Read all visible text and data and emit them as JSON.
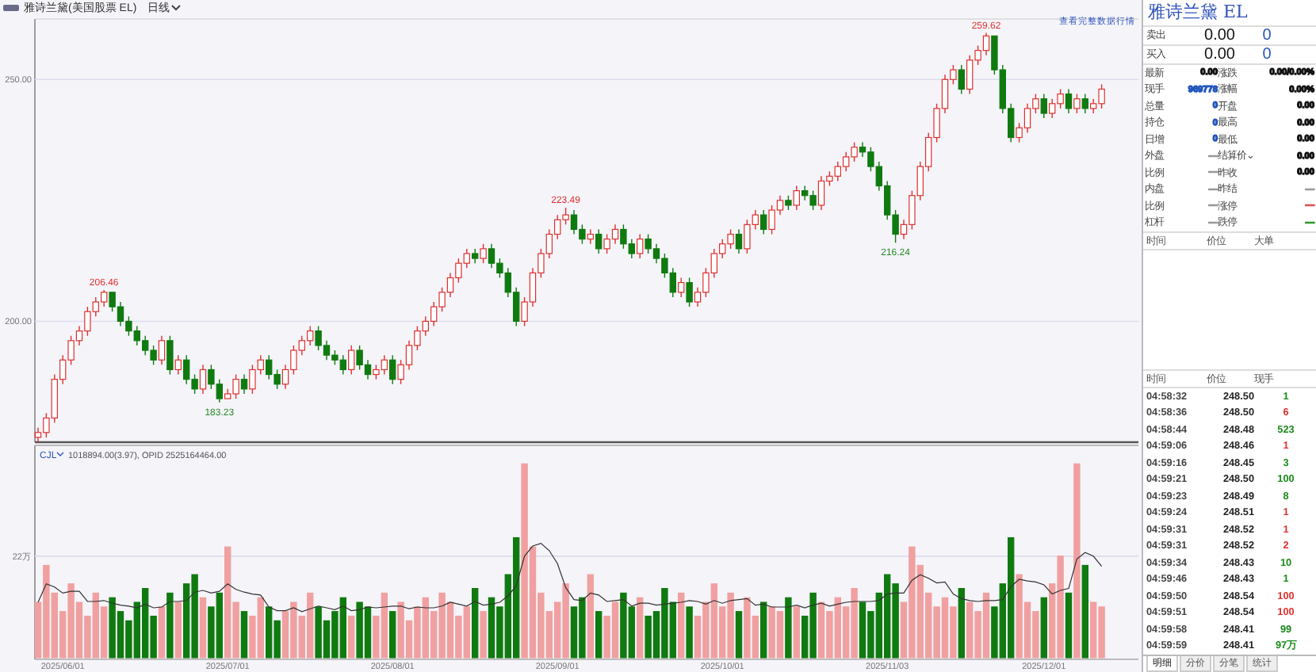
{
  "header": {
    "title": "雅诗兰黛(美国股票 EL)",
    "period": "日线"
  },
  "price_chart": {
    "link": "查看完整数据行情",
    "chart_data": {
      "type": "candlestick",
      "ohlc": [
        [
          176,
          178,
          175,
          177
        ],
        [
          177,
          181,
          176,
          180
        ],
        [
          180,
          189,
          179,
          188
        ],
        [
          188,
          193,
          187,
          192
        ],
        [
          192,
          197,
          191,
          196
        ],
        [
          196,
          199,
          195,
          198
        ],
        [
          198,
          203,
          197,
          202
        ],
        [
          202,
          205,
          201,
          204
        ],
        [
          204,
          206.46,
          203,
          206
        ],
        [
          206,
          206,
          202,
          203
        ],
        [
          203,
          204,
          199,
          200
        ],
        [
          200,
          201,
          197,
          198
        ],
        [
          198,
          199,
          195,
          196
        ],
        [
          196,
          197,
          193,
          194
        ],
        [
          194,
          195,
          191,
          192
        ],
        [
          192,
          197,
          191,
          196
        ],
        [
          196,
          197,
          189,
          190
        ],
        [
          190,
          193,
          189,
          192
        ],
        [
          192,
          193,
          187,
          188
        ],
        [
          188,
          189,
          185,
          186
        ],
        [
          186,
          191,
          185,
          190
        ],
        [
          190,
          191,
          186,
          187
        ],
        [
          187,
          188,
          183.23,
          184
        ],
        [
          184,
          186,
          184,
          185
        ],
        [
          185,
          189,
          184,
          188
        ],
        [
          188,
          189,
          185,
          186
        ],
        [
          186,
          191,
          185,
          190
        ],
        [
          190,
          193,
          189,
          192
        ],
        [
          192,
          193,
          188,
          189
        ],
        [
          189,
          190,
          186,
          187
        ],
        [
          187,
          191,
          186,
          190
        ],
        [
          190,
          195,
          189,
          194
        ],
        [
          194,
          197,
          193,
          196
        ],
        [
          196,
          199,
          195,
          198
        ],
        [
          198,
          199,
          194,
          195
        ],
        [
          195,
          196,
          192,
          193
        ],
        [
          193,
          194,
          191,
          192
        ],
        [
          192,
          193,
          189,
          190
        ],
        [
          190,
          195,
          189,
          194
        ],
        [
          194,
          195,
          190,
          191
        ],
        [
          191,
          192,
          188,
          189
        ],
        [
          189,
          191,
          188,
          190
        ],
        [
          190,
          193,
          189,
          192
        ],
        [
          192,
          193,
          187,
          188
        ],
        [
          188,
          192,
          187,
          191
        ],
        [
          191,
          196,
          190,
          195
        ],
        [
          195,
          199,
          194,
          198
        ],
        [
          198,
          201,
          197,
          200
        ],
        [
          200,
          204,
          199,
          203
        ],
        [
          203,
          207,
          202,
          206
        ],
        [
          206,
          210,
          205,
          209
        ],
        [
          209,
          213,
          208,
          212
        ],
        [
          212,
          215,
          211,
          214
        ],
        [
          214,
          215,
          212,
          213
        ],
        [
          213,
          216,
          212,
          215
        ],
        [
          215,
          216,
          211,
          212
        ],
        [
          212,
          213,
          209,
          210
        ],
        [
          210,
          211,
          205,
          206
        ],
        [
          206,
          207,
          199,
          200
        ],
        [
          200,
          205,
          199,
          204
        ],
        [
          204,
          211,
          203,
          210
        ],
        [
          210,
          215,
          209,
          214
        ],
        [
          214,
          219,
          213,
          218
        ],
        [
          218,
          222,
          217,
          221
        ],
        [
          221,
          223.49,
          220,
          222
        ],
        [
          222,
          223,
          218,
          219
        ],
        [
          219,
          220,
          216,
          217
        ],
        [
          217,
          219,
          216,
          218
        ],
        [
          218,
          219,
          214,
          215
        ],
        [
          215,
          218,
          214,
          217
        ],
        [
          217,
          220,
          216,
          219
        ],
        [
          219,
          220,
          215,
          216
        ],
        [
          216,
          217,
          213,
          214
        ],
        [
          214,
          218,
          213,
          217
        ],
        [
          217,
          218,
          214,
          215
        ],
        [
          215,
          216,
          212,
          213
        ],
        [
          213,
          214,
          209,
          210
        ],
        [
          210,
          211,
          205,
          206
        ],
        [
          206,
          209,
          205,
          208
        ],
        [
          208,
          209,
          203,
          204
        ],
        [
          204,
          207,
          203,
          206
        ],
        [
          206,
          211,
          205,
          210
        ],
        [
          210,
          215,
          209,
          214
        ],
        [
          214,
          217,
          213,
          216
        ],
        [
          216,
          219,
          215,
          218
        ],
        [
          218,
          219,
          214,
          215
        ],
        [
          215,
          221,
          214,
          220
        ],
        [
          220,
          223,
          219,
          222
        ],
        [
          222,
          223,
          218,
          219
        ],
        [
          219,
          224,
          218,
          223
        ],
        [
          223,
          226,
          222,
          225
        ],
        [
          225,
          226,
          223,
          224
        ],
        [
          224,
          228,
          223,
          227
        ],
        [
          227,
          228,
          225,
          226
        ],
        [
          226,
          227,
          223,
          224
        ],
        [
          224,
          230,
          223,
          229
        ],
        [
          229,
          231,
          228,
          230
        ],
        [
          230,
          233,
          229,
          232
        ],
        [
          232,
          235,
          231,
          234
        ],
        [
          234,
          237,
          233,
          236
        ],
        [
          236,
          237,
          234,
          235
        ],
        [
          235,
          236,
          231,
          232
        ],
        [
          232,
          233,
          227,
          228
        ],
        [
          228,
          229,
          221,
          222
        ],
        [
          222,
          223,
          216.24,
          218
        ],
        [
          218,
          221,
          217,
          220
        ],
        [
          220,
          227,
          219,
          226
        ],
        [
          226,
          233,
          225,
          232
        ],
        [
          232,
          239,
          231,
          238
        ],
        [
          238,
          245,
          237,
          244
        ],
        [
          244,
          251,
          243,
          250
        ],
        [
          250,
          253,
          249,
          252
        ],
        [
          252,
          253,
          247,
          248
        ],
        [
          248,
          255,
          247,
          254
        ],
        [
          254,
          257,
          253,
          256
        ],
        [
          256,
          259.62,
          255,
          259
        ],
        [
          259,
          259,
          251,
          252
        ],
        [
          252,
          253,
          243,
          244
        ],
        [
          244,
          245,
          237,
          238
        ],
        [
          238,
          241,
          237,
          240
        ],
        [
          240,
          245,
          239,
          244
        ],
        [
          244,
          247,
          243,
          246
        ],
        [
          246,
          247,
          242,
          243
        ],
        [
          243,
          246,
          242,
          245
        ],
        [
          245,
          248,
          244,
          247
        ],
        [
          247,
          248,
          243,
          244
        ],
        [
          244,
          247,
          243,
          246
        ],
        [
          246,
          247,
          243,
          244
        ],
        [
          244,
          246,
          243,
          245
        ],
        [
          245,
          249,
          244,
          248
        ]
      ],
      "ylim": [
        175,
        262.5
      ],
      "yticks": [
        {
          "value": 250,
          "label": "250.00"
        },
        {
          "value": 200,
          "label": "200.00"
        }
      ],
      "annotations": [
        {
          "y": 206.46,
          "text": "206.46"
        },
        {
          "y": 183.23,
          "text": "183.23"
        },
        {
          "y": 223.49,
          "text": "223.49"
        },
        {
          "y": 216.24,
          "text": "216.24"
        },
        {
          "y": 259.62,
          "text": "259.62"
        }
      ]
    }
  },
  "volume_chart": {
    "legend_text": "1018894.00(3.97), OPID 2525164464.00",
    "chart_data": {
      "type": "bar",
      "categories": [
        null,
        null,
        null,
        "2025/06/01",
        null,
        null,
        null,
        null,
        null,
        null,
        null,
        null,
        null,
        null,
        null,
        null,
        null,
        null,
        null,
        null,
        null,
        null,
        null,
        "2025/07/01",
        null,
        null,
        null,
        null,
        null,
        null,
        null,
        null,
        null,
        null,
        null,
        null,
        null,
        null,
        null,
        null,
        null,
        null,
        null,
        "2025/08/01",
        null,
        null,
        null,
        null,
        null,
        null,
        null,
        null,
        null,
        null,
        null,
        null,
        null,
        null,
        null,
        null,
        null,
        null,
        null,
        "2025/09/01",
        null,
        null,
        null,
        null,
        null,
        null,
        null,
        null,
        null,
        null,
        null,
        null,
        null,
        null,
        null,
        null,
        null,
        null,
        null,
        "2025/10/01",
        null,
        null,
        null,
        null,
        null,
        null,
        null,
        null,
        null,
        null,
        null,
        null,
        null,
        null,
        null,
        null,
        null,
        null,
        null,
        "2025/11/03",
        null,
        null,
        null,
        null,
        null,
        null,
        null,
        null,
        null,
        null,
        null,
        null,
        null,
        null,
        null,
        null,
        null,
        null,
        "2025/12/01",
        null,
        null,
        null,
        null,
        null,
        null,
        null
      ],
      "series": [
        {
          "name": "CJL",
          "colors": [
            "#f0a0a0",
            "#f0a0a0",
            "#f0a0a0",
            "#f0a0a0",
            "#f0a0a0",
            "#f0a0a0",
            "#f0a0a0",
            "#f0a0a0",
            "#f0a0a0",
            "#0f7a0f",
            "#0f7a0f",
            "#0f7a0f",
            "#0f7a0f",
            "#0f7a0f",
            "#0f7a0f",
            "#f0a0a0",
            "#0f7a0f",
            "#f0a0a0",
            "#0f7a0f",
            "#0f7a0f",
            "#f0a0a0",
            "#0f7a0f",
            "#0f7a0f",
            "#f0a0a0",
            "#f0a0a0",
            "#0f7a0f",
            "#f0a0a0",
            "#f0a0a0",
            "#0f7a0f",
            "#0f7a0f",
            "#f0a0a0",
            "#f0a0a0",
            "#f0a0a0",
            "#f0a0a0",
            "#0f7a0f",
            "#0f7a0f",
            "#0f7a0f",
            "#0f7a0f",
            "#f0a0a0",
            "#0f7a0f",
            "#0f7a0f",
            "#f0a0a0",
            "#f0a0a0",
            "#0f7a0f",
            "#f0a0a0",
            "#f0a0a0",
            "#f0a0a0",
            "#f0a0a0",
            "#f0a0a0",
            "#f0a0a0",
            "#f0a0a0",
            "#f0a0a0",
            "#f0a0a0",
            "#0f7a0f",
            "#f0a0a0",
            "#0f7a0f",
            "#0f7a0f",
            "#0f7a0f",
            "#0f7a0f",
            "#f0a0a0",
            "#f0a0a0",
            "#f0a0a0",
            "#f0a0a0",
            "#f0a0a0",
            "#f0a0a0",
            "#0f7a0f",
            "#0f7a0f",
            "#f0a0a0",
            "#0f7a0f",
            "#f0a0a0",
            "#f0a0a0",
            "#0f7a0f",
            "#0f7a0f",
            "#f0a0a0",
            "#0f7a0f",
            "#0f7a0f",
            "#0f7a0f",
            "#0f7a0f",
            "#f0a0a0",
            "#0f7a0f",
            "#f0a0a0",
            "#f0a0a0",
            "#f0a0a0",
            "#f0a0a0",
            "#f0a0a0",
            "#0f7a0f",
            "#f0a0a0",
            "#f0a0a0",
            "#0f7a0f",
            "#f0a0a0",
            "#f0a0a0",
            "#0f7a0f",
            "#f0a0a0",
            "#0f7a0f",
            "#0f7a0f",
            "#f0a0a0",
            "#f0a0a0",
            "#f0a0a0",
            "#f0a0a0",
            "#f0a0a0",
            "#0f7a0f",
            "#0f7a0f",
            "#0f7a0f",
            "#0f7a0f",
            "#0f7a0f",
            "#f0a0a0",
            "#f0a0a0",
            "#f0a0a0",
            "#f0a0a0",
            "#f0a0a0",
            "#f0a0a0",
            "#f0a0a0",
            "#0f7a0f",
            "#f0a0a0",
            "#f0a0a0",
            "#f0a0a0",
            "#0f7a0f",
            "#0f7a0f",
            "#0f7a0f",
            "#f0a0a0",
            "#f0a0a0",
            "#f0a0a0",
            "#0f7a0f",
            "#f0a0a0",
            "#f0a0a0",
            "#0f7a0f",
            "#f0a0a0",
            "#0f7a0f",
            "#f0a0a0",
            "#f0a0a0"
          ],
          "values": [
            12,
            20,
            14,
            10,
            16,
            12,
            9,
            14,
            11,
            13,
            10,
            8,
            12,
            15,
            9,
            11,
            14,
            12,
            16,
            18,
            13,
            11,
            14,
            24,
            12,
            10,
            9,
            13,
            11,
            8,
            10,
            12,
            9,
            14,
            11,
            8,
            10,
            13,
            9,
            12,
            11,
            9,
            14,
            10,
            12,
            8,
            11,
            13,
            10,
            14,
            12,
            9,
            11,
            15,
            10,
            13,
            11,
            18,
            26,
            42,
            24,
            14,
            10,
            12,
            16,
            11,
            13,
            18,
            10,
            9,
            12,
            14,
            11,
            13,
            9,
            10,
            15,
            12,
            14,
            11,
            9,
            12,
            16,
            11,
            14,
            10,
            13,
            9,
            12,
            11,
            10,
            13,
            11,
            9,
            14,
            12,
            10,
            13,
            11,
            15,
            12,
            10,
            14,
            18,
            16,
            12,
            24,
            20,
            14,
            11,
            13,
            11,
            15,
            12,
            10,
            14,
            11,
            16,
            26,
            18,
            12,
            10,
            13,
            16,
            22,
            14,
            42,
            20,
            12,
            11
          ]
        },
        {
          "type": "line",
          "values": [
            12,
            16,
            15.3,
            14,
            14.4,
            14.4,
            12.2,
            12.2,
            12.4,
            11.8,
            11.4,
            11.2,
            10.8,
            11.6,
            10.8,
            11,
            12.2,
            12.2,
            12.4,
            14.2,
            14.6,
            14,
            14.4,
            16,
            14.8,
            14.2,
            13.8,
            13.6,
            11,
            10.2,
            10.2,
            10.8,
            10,
            10.6,
            11.2,
            10.8,
            10.4,
            11.2,
            10.2,
            10.4,
            11,
            10.8,
            11,
            11.2,
            11.2,
            10.6,
            11,
            10.8,
            10.8,
            11.2,
            12,
            11.6,
            11.2,
            12.2,
            11.4,
            11.6,
            12,
            13.4,
            15.6,
            22,
            24.2,
            24.8,
            23.2,
            20.4,
            15.2,
            12.6,
            12.4,
            14,
            13.6,
            12.2,
            12.4,
            12.6,
            11.2,
            11.8,
            11.8,
            11.4,
            11.6,
            11.8,
            12,
            12.4,
            12.2,
            11.6,
            12.4,
            11.8,
            12.4,
            12.6,
            12.8,
            11.4,
            11.6,
            11,
            11,
            11,
            11.4,
            10.8,
            11.4,
            11.8,
            11.2,
            11.6,
            12,
            12.2,
            12.2,
            12.2,
            12.4,
            13.8,
            14,
            14,
            16.8,
            18,
            17.2,
            16.2,
            16.4,
            13.8,
            12.8,
            12.4,
            12.2,
            12.4,
            12.4,
            12.6,
            15.4,
            17,
            16.6,
            16.4,
            15.8,
            13.8,
            14.6,
            15,
            21.4,
            22.8,
            22,
            19.8
          ]
        }
      ],
      "ylim": [
        0,
        46
      ],
      "yticks": [
        {
          "value": 22,
          "label": "22万"
        }
      ]
    }
  },
  "quote_panel": {
    "name": "雅诗兰黛",
    "code": "EL",
    "book": [
      {
        "label": "卖出",
        "price": "0.00",
        "volume": "0"
      },
      {
        "label": "买入",
        "price": "0.00",
        "volume": "0"
      }
    ],
    "stats": [
      [
        {
          "label": "最新",
          "value": "0.00",
          "color": "#111111"
        },
        {
          "label": "涨跌",
          "value": "0.00/0.00%",
          "color": "#111111"
        }
      ],
      [
        {
          "label": "现手",
          "value": "969778",
          "color": "#2255bb"
        },
        {
          "label": "涨幅",
          "value": "0.00%",
          "color": "#111111"
        }
      ],
      [
        {
          "label": "总量",
          "value": "0",
          "color": "#2255bb"
        },
        {
          "label": "开盘",
          "value": "0.00",
          "color": "#111111"
        }
      ],
      [
        {
          "label": "持仓",
          "value": "0",
          "color": "#2255bb"
        },
        {
          "label": "最高",
          "value": "0.00",
          "color": "#111111"
        }
      ],
      [
        {
          "label": "日增",
          "value": "0",
          "color": "#2255bb"
        },
        {
          "label": "最低",
          "value": "0.00",
          "color": "#111111"
        }
      ],
      [
        {
          "label": "外盘",
          "value": "—",
          "color": "#999999"
        },
        {
          "label": "结算价⌄",
          "value": "0.00",
          "color": "#111111"
        }
      ],
      [
        {
          "label": "比例",
          "value": "—",
          "color": "#999999"
        },
        {
          "label": "昨收",
          "value": "0.00",
          "color": "#111111"
        }
      ],
      [
        {
          "label": "内盘",
          "value": "—",
          "color": "#999999"
        },
        {
          "label": "昨结",
          "value": "—",
          "color": "#999999"
        }
      ],
      [
        {
          "label": "比例",
          "value": "—",
          "color": "#999999"
        },
        {
          "label": "涨停",
          "value": "—",
          "color": "#e05050"
        }
      ],
      [
        {
          "label": "杠杆",
          "value": "—",
          "color": "#999999"
        },
        {
          "label": "跌停",
          "value": "—",
          "color": "#2a9a2a"
        }
      ]
    ],
    "big_orders_columns": [
      "时间",
      "价位",
      "大单"
    ],
    "trades_columns": [
      "时间",
      "价位",
      "现手"
    ],
    "trades": [
      {
        "time": "04:58:32",
        "price": "248.50",
        "volume": "1",
        "color": "#1a8a1a"
      },
      {
        "time": "04:58:36",
        "price": "248.50",
        "volume": "6",
        "color": "#e03030"
      },
      {
        "time": "04:58:44",
        "price": "248.48",
        "volume": "523",
        "color": "#1a8a1a"
      },
      {
        "time": "04:59:06",
        "price": "248.46",
        "volume": "1",
        "color": "#e03030"
      },
      {
        "time": "04:59:16",
        "price": "248.45",
        "volume": "3",
        "color": "#1a8a1a"
      },
      {
        "time": "04:59:21",
        "price": "248.50",
        "volume": "100",
        "color": "#1a8a1a"
      },
      {
        "time": "04:59:23",
        "price": "248.49",
        "volume": "8",
        "color": "#1a8a1a"
      },
      {
        "time": "04:59:24",
        "price": "248.51",
        "volume": "1",
        "color": "#e03030"
      },
      {
        "time": "04:59:31",
        "price": "248.52",
        "volume": "1",
        "color": "#e03030"
      },
      {
        "time": "04:59:31",
        "price": "248.52",
        "volume": "2",
        "color": "#e03030"
      },
      {
        "time": "04:59:34",
        "price": "248.43",
        "volume": "10",
        "color": "#1a8a1a"
      },
      {
        "time": "04:59:46",
        "price": "248.43",
        "volume": "1",
        "color": "#1a8a1a"
      },
      {
        "time": "04:59:50",
        "price": "248.54",
        "volume": "100",
        "color": "#e03030"
      },
      {
        "time": "04:59:51",
        "price": "248.54",
        "volume": "100",
        "color": "#e03030"
      },
      {
        "time": "04:59:58",
        "price": "248.41",
        "volume": "99",
        "color": "#1a8a1a"
      },
      {
        "time": "04:59:59",
        "price": "248.41",
        "volume": "97万",
        "color": "#1a8a1a"
      }
    ],
    "tabs": [
      {
        "label": "明细",
        "selected": true
      },
      {
        "label": "分价",
        "selected": false
      },
      {
        "label": "分笔",
        "selected": false
      },
      {
        "label": "统计",
        "selected": false
      }
    ]
  }
}
